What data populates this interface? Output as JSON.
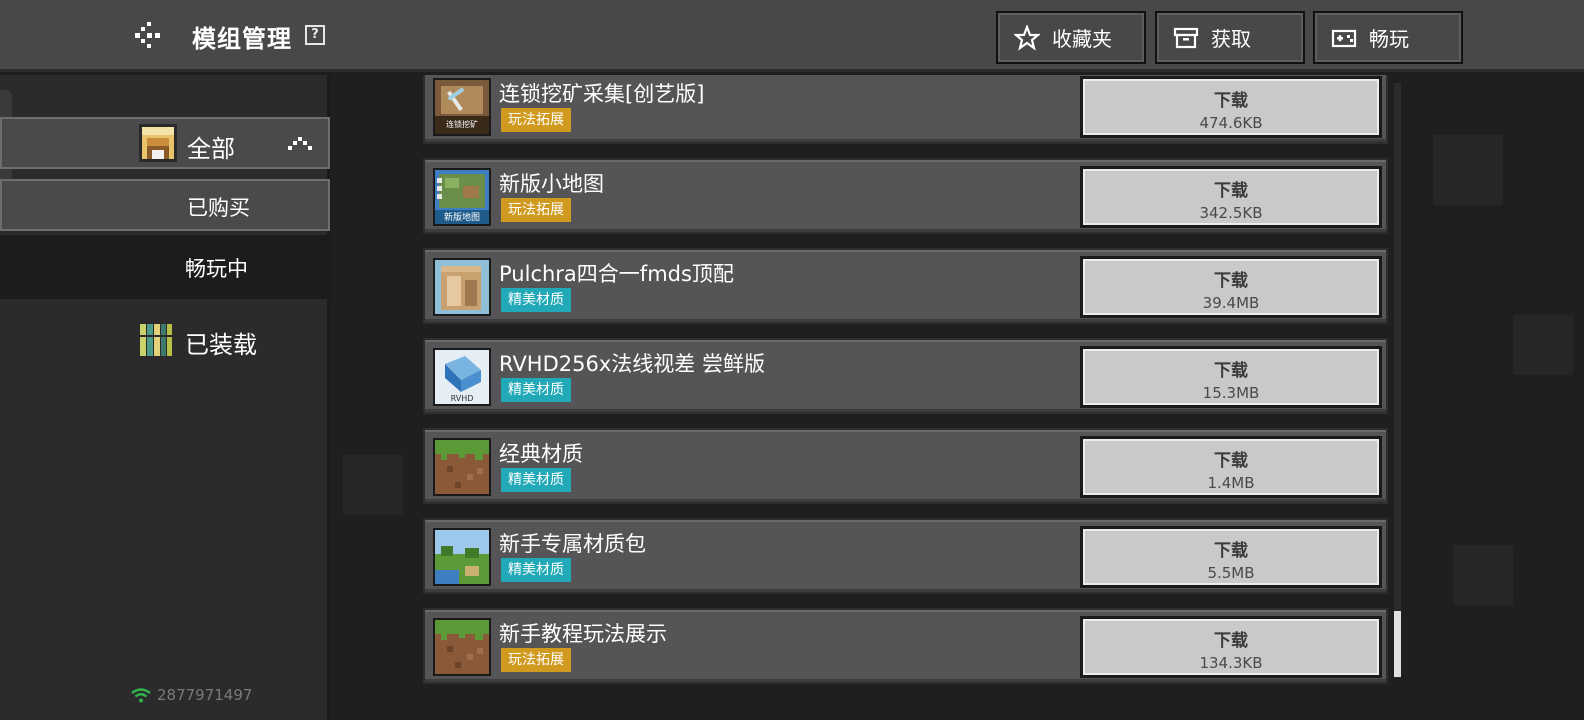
{
  "header": {
    "title": "模组管理",
    "help_symbol": "?",
    "buttons": [
      {
        "label": "收藏夹",
        "icon": "star-icon"
      },
      {
        "label": "获取",
        "icon": "chest-icon"
      },
      {
        "label": "畅玩",
        "icon": "gamepad-icon"
      }
    ]
  },
  "sidebar": {
    "items": [
      {
        "label": "全部",
        "icon": "all-mods-icon",
        "expanded": true
      },
      {
        "label": "已购买"
      },
      {
        "label": "畅玩中"
      },
      {
        "label": "已装载",
        "icon": "bookshelf-icon"
      }
    ],
    "user_id": "2877971497"
  },
  "mods": [
    {
      "name": "连锁挖矿采集[创艺版]",
      "tag": "玩法拓展",
      "tag_type": "gameplay",
      "button": "下载",
      "size": "474.6KB",
      "thumb_text": "连锁挖矿"
    },
    {
      "name": "新版小地图",
      "tag": "玩法拓展",
      "tag_type": "gameplay",
      "button": "下载",
      "size": "342.5KB",
      "thumb_text": "新版地图"
    },
    {
      "name": "Pulchra四合一fmds顶配",
      "tag": "精美材质",
      "tag_type": "texture",
      "button": "下载",
      "size": "39.4MB"
    },
    {
      "name": "RVHD256x法线视差 尝鲜版",
      "tag": "精美材质",
      "tag_type": "texture",
      "button": "下载",
      "size": "15.3MB",
      "thumb_text": "RVHD"
    },
    {
      "name": "经典材质",
      "tag": "精美材质",
      "tag_type": "texture",
      "button": "下载",
      "size": "1.4MB"
    },
    {
      "name": "新手专属材质包",
      "tag": "精美材质",
      "tag_type": "texture",
      "button": "下载",
      "size": "5.5MB"
    },
    {
      "name": "新手教程玩法展示",
      "tag": "玩法拓展",
      "tag_type": "gameplay",
      "button": "下载",
      "size": "134.3KB"
    }
  ],
  "colors": {
    "gameplay_tag": "#d09a1e",
    "texture_tag": "#22a9b8",
    "header_bg": "#48484a",
    "row_bg": "#555557",
    "download_button": "#c9c9c9"
  }
}
